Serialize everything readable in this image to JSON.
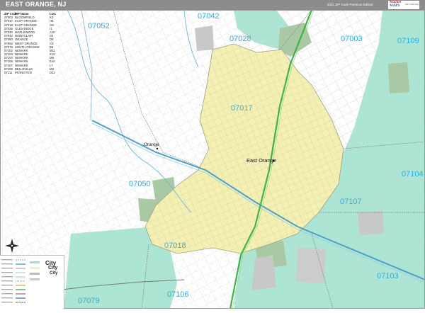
{
  "header": {
    "title": "EAST ORANGE, NJ",
    "edition": "2021 ZIP Code Premium Edition",
    "logo_line1": "Market",
    "logo_line2": "MAPS",
    "logo_line3": "ZIP Code Map"
  },
  "colors": {
    "city": "#f4f0b4",
    "green_zone": "#9fe0cc",
    "park": "#a9c9a4",
    "zip_label": "#2ab0e0",
    "header": "#8c8c8c"
  },
  "zip_table": {
    "headers": [
      "ZIP Code",
      "ZIP Name",
      "LOC"
    ],
    "rows": [
      [
        "07003",
        "BLOOMFIELD",
        "K3"
      ],
      [
        "07017",
        "EAST ORANGE",
        "H5"
      ],
      [
        "07018",
        "EAST ORANGE",
        "G8"
      ],
      [
        "07028",
        "GLEN RIDGE",
        "I1"
      ],
      [
        "07040",
        "MAPLEWOOD",
        "A10"
      ],
      [
        "07042",
        "MONTCLAIR",
        "G1"
      ],
      [
        "07050",
        "ORANGE",
        "D5"
      ],
      [
        "07052",
        "WEST ORANGE",
        "C5"
      ],
      [
        "07079",
        "SOUTH ORANGE",
        "B9"
      ],
      [
        "07102",
        "NEWARK",
        "M11"
      ],
      [
        "07103",
        "NEWARK",
        "K10"
      ],
      [
        "07104",
        "NEWARK",
        "M6"
      ],
      [
        "07106",
        "NEWARK",
        "E10"
      ],
      [
        "07107",
        "NEWARK",
        "L7"
      ],
      [
        "07109",
        "BELLEVILLE",
        "M2"
      ],
      [
        "07111",
        "IRVINGTON",
        "D11"
      ]
    ]
  },
  "map_labels": {
    "zips": {
      "z07042": "07042",
      "z07052": "07052",
      "z07028": "07028",
      "z07003": "07003",
      "z07109": "07109",
      "z07017": "07017",
      "z07104": "07104",
      "z07050": "07050",
      "z07107": "07107",
      "z07018": "07018",
      "z07103": "07103",
      "z07106": "07106",
      "z07079": "07079"
    },
    "places": {
      "east_orange": "East Orange",
      "orange": "Orange"
    }
  },
  "legend": {
    "city_label": "City"
  }
}
